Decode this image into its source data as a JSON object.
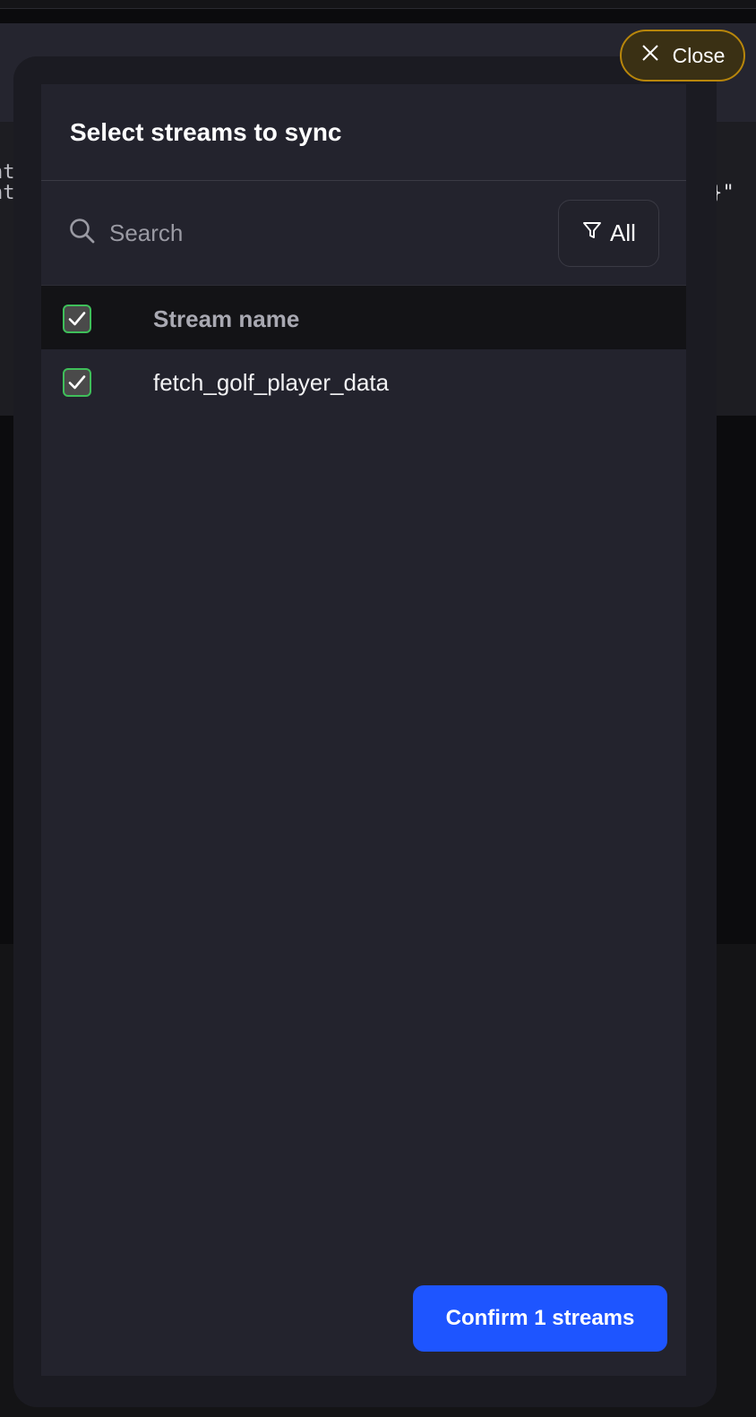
{
  "background": {
    "fragment_1": "nt",
    "fragment_2": "nt",
    "fragment_3": "·}\""
  },
  "close_button": {
    "label": "Close",
    "icon": "close-icon"
  },
  "modal": {
    "title": "Select streams to sync",
    "search": {
      "placeholder": "Search",
      "value": "",
      "icon": "search-icon"
    },
    "filter": {
      "label": "All",
      "icon": "filter-icon"
    },
    "table": {
      "header": {
        "column": "Stream name",
        "select_all_checked": true
      },
      "rows": [
        {
          "name": "fetch_golf_player_data",
          "checked": true
        }
      ]
    },
    "confirm_button": {
      "label": "Confirm 1 streams"
    }
  },
  "colors": {
    "accent_blue": "#1e55ff",
    "close_border": "#b8860b",
    "checkbox_border": "#3fbf5a"
  }
}
